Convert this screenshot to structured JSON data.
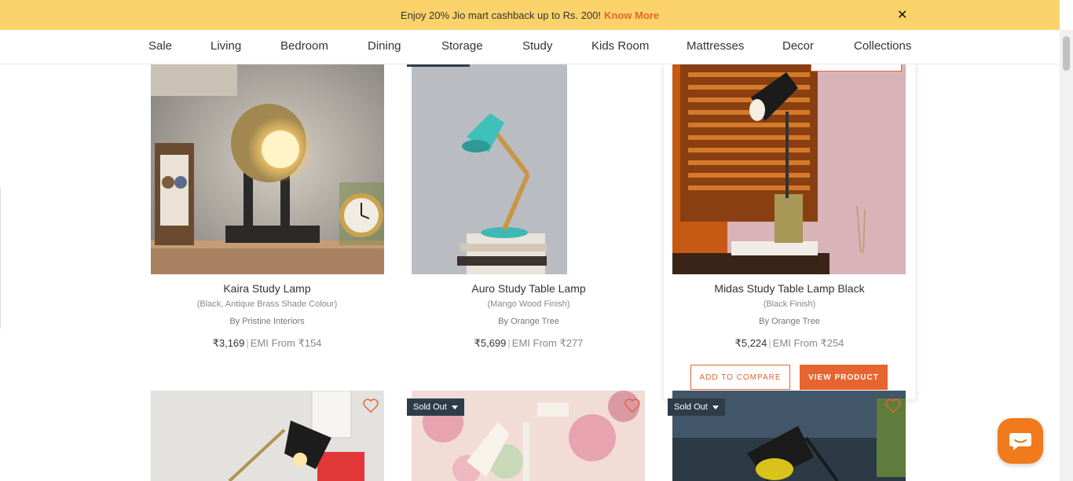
{
  "banner": {
    "text": "Enjoy 20% Jio mart cashback up to Rs. 200!",
    "link": "Know More",
    "close": "✕"
  },
  "nav": {
    "items": [
      "Sale",
      "Living",
      "Bedroom",
      "Dining",
      "Storage",
      "Study",
      "Kids Room",
      "Mattresses",
      "Decor",
      "Collections"
    ]
  },
  "products": [
    {
      "name": "Kaira Study Lamp",
      "variant": "(Black, Antique Brass Shade Colour)",
      "brand": "By Pristine Interiors",
      "price": "₹3,169",
      "emi": "EMI From ₹154"
    },
    {
      "name": "Auro Study Table Lamp",
      "variant": "(Mango Wood Finish)",
      "brand": "By Orange Tree",
      "price": "₹5,699",
      "emi": "EMI From ₹277"
    },
    {
      "name": "Midas Study Table Lamp Black",
      "variant": "(Black Finish)",
      "brand": "By Orange Tree",
      "price": "₹5,224",
      "emi": "EMI From ₹254"
    }
  ],
  "actions": {
    "compare": "ADD TO COMPARE",
    "view": "VIEW PRODUCT"
  },
  "badges": {
    "sold_out": "Sold Out"
  },
  "colors": {
    "accent": "#e6642f",
    "banner_bg": "#fcd36a",
    "badge_bg": "#2f3d4a"
  },
  "icons": [
    "close-icon",
    "heart-icon",
    "chat-icon",
    "caret-down-icon"
  ]
}
